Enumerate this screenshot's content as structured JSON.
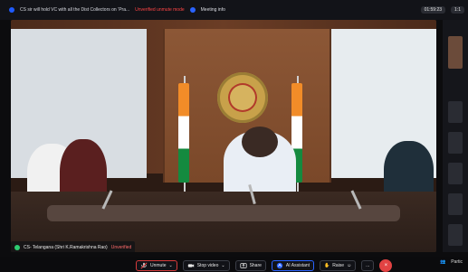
{
  "topbar": {
    "title": "CS sir will hold VC with all the Dist Collectors on ‘Pra...",
    "unverified": "Unverified unmute mode",
    "meeting_info": "Meeting info",
    "time": "01:59:23",
    "count": "1:1"
  },
  "stage": {
    "name_tag_prefix": "CS- Telangana (Shri K.Ramakrishna Rao)",
    "name_tag_status": "Unverified"
  },
  "toolbar": {
    "unmute": "Unmute",
    "stop_video": "Stop video",
    "share": "Share",
    "ai_assistant": "AI Assistant",
    "raise": "Raise",
    "more": "...",
    "end": "×",
    "participants": "Partic"
  },
  "icons": {
    "mic": "mic-off-icon",
    "video": "video-icon",
    "share": "share-icon",
    "ai": "ai-assistant-icon",
    "raise": "raise-hand-icon",
    "end": "end-call-icon",
    "participants": "participants-icon"
  },
  "colors": {
    "accent_blue": "#2a63ff",
    "danger_red": "#e24343"
  }
}
